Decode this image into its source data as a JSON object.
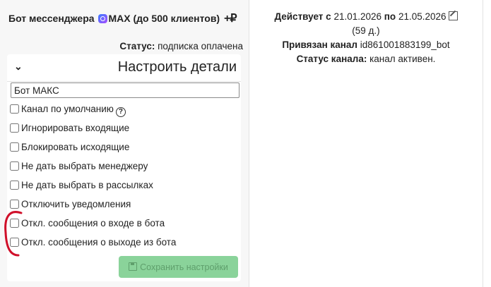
{
  "plan": {
    "title": "Бот мессенджера",
    "brand": "MAX (до 500 клиентов)",
    "icons": "+₽",
    "status_label": "Статус:",
    "status_value": "подписка оплачена"
  },
  "panel": {
    "title": "Настроить детали",
    "name_value": "Бот МАКС",
    "options": [
      {
        "label": "Канал по умолчанию",
        "checked": false,
        "help": true
      },
      {
        "label": "Игнорировать входящие",
        "checked": false
      },
      {
        "label": "Блокировать исходящие",
        "checked": false
      },
      {
        "label": "Не дать выбрать менеджеру",
        "checked": false
      },
      {
        "label": "Не дать выбрать в рассылках",
        "checked": false
      },
      {
        "label": "Отключить уведомления",
        "checked": false
      },
      {
        "label": "Откл. сообщения о входе в бота",
        "checked": false
      },
      {
        "label": "Откл. сообщения о выходе из бота",
        "checked": false
      }
    ],
    "save_label": "Сохранить настройки",
    "help_glyph": "?"
  },
  "info": {
    "active_label": "Действует с",
    "date_from": "21.01.2026",
    "to_label": "по",
    "date_to": "21.05.2026",
    "days": "(59 д.)",
    "bound_label": "Привязан канал",
    "channel_id": "id861001883199_bot",
    "channel_status_label": "Статус канала:",
    "channel_status_value": "канал активен."
  },
  "colors": {
    "save_bg": "#8ad39a",
    "annotation": "#d0102a"
  }
}
